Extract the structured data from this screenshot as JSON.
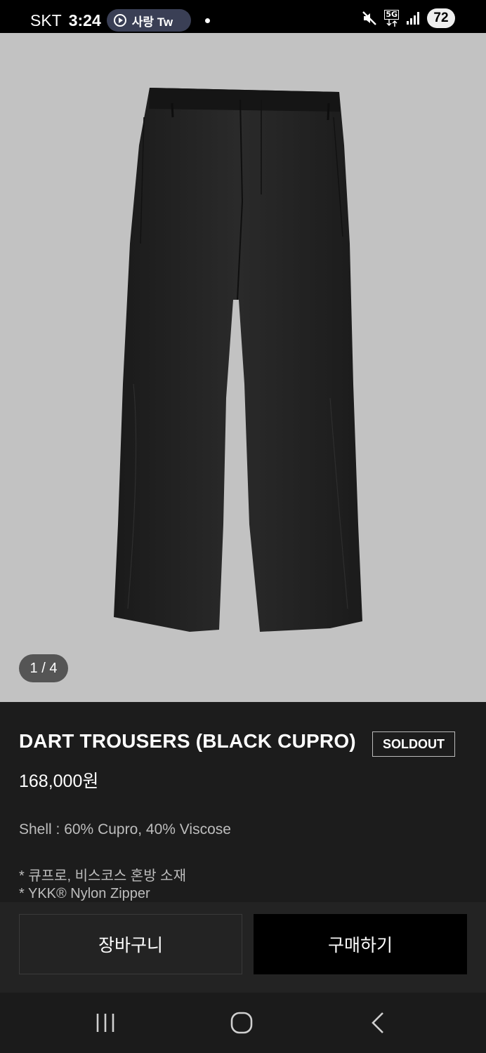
{
  "status_bar": {
    "carrier": "SKT",
    "time": "3:24",
    "media_pill": "사랑 Tw",
    "network": "5G",
    "battery": "72",
    "icons": [
      "mute-icon",
      "5g-icon",
      "signal-icon",
      "battery-icon"
    ]
  },
  "gallery": {
    "counter": "1 / 4",
    "background": "#c2c2c2",
    "image_subject": "black trousers"
  },
  "product": {
    "title": "DART TROUSERS (BLACK CUPRO)",
    "badge": "SOLDOUT",
    "price": "168,000원",
    "spec": "Shell : 60% Cupro, 40% Viscose",
    "notes": [
      "*  큐프로, 비스코스 혼방 소재",
      "* YKK® Nylon Zipper"
    ]
  },
  "actions": {
    "cart_label": "장바구니",
    "buy_label": "구매하기"
  },
  "nav": {
    "icons": [
      "recents-icon",
      "home-icon",
      "back-icon"
    ]
  }
}
